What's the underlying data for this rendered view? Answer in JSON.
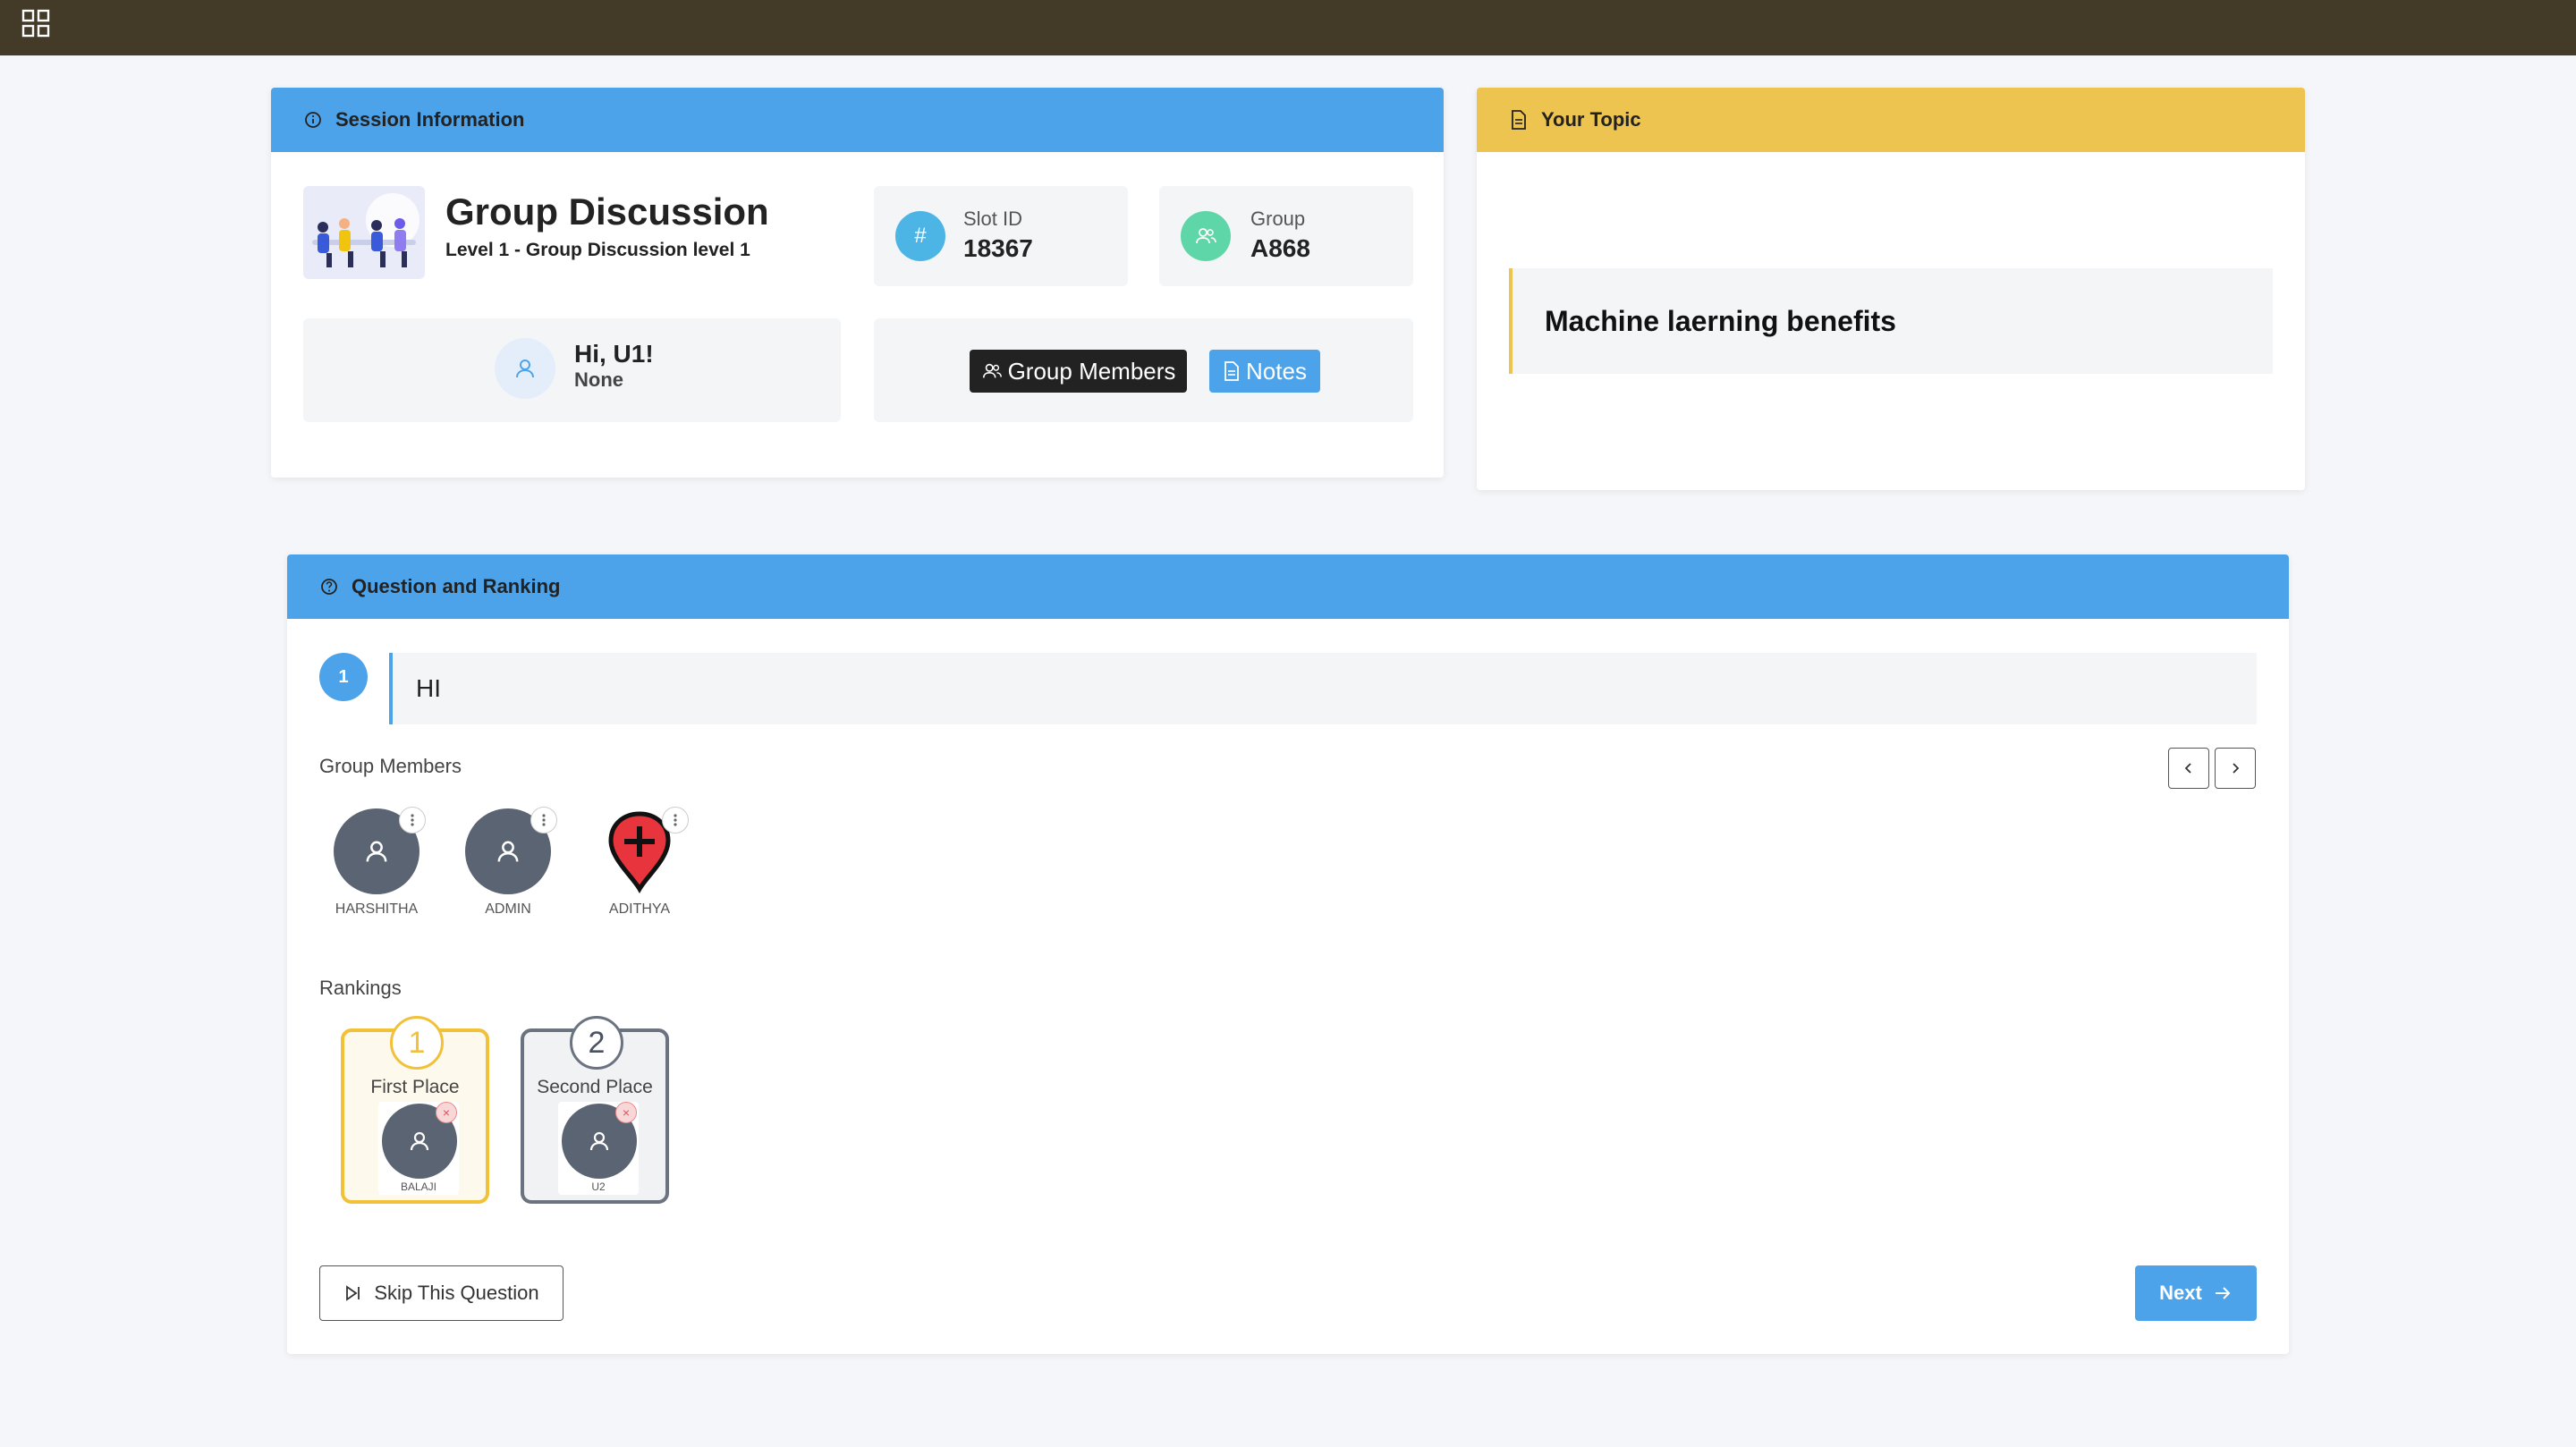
{
  "topbar": {
    "apps_icon": "grid-icon"
  },
  "session": {
    "header": "Session Information",
    "title": "Group Discussion",
    "subtitle": "Level 1 - Group Discussion level 1",
    "slot": {
      "label": "Slot ID",
      "value": "18367",
      "icon": "hash-icon"
    },
    "group": {
      "label": "Group",
      "value": "A868",
      "icon": "users-icon"
    },
    "user": {
      "greeting": "Hi, U1!",
      "role": "None"
    },
    "buttons": {
      "members": "Group Members",
      "notes": "Notes"
    }
  },
  "topic": {
    "header": "Your Topic",
    "text": "Machine laerning benefits"
  },
  "question": {
    "header": "Question and Ranking",
    "number": "1",
    "text": "HI",
    "members_label": "Group Members",
    "members": [
      {
        "name": "HARSHITHA"
      },
      {
        "name": "ADMIN"
      },
      {
        "name": "ADITHYA"
      }
    ],
    "rankings_label": "Rankings",
    "rankings": [
      {
        "num": "1",
        "label": "First Place",
        "name": "BALAJI"
      },
      {
        "num": "2",
        "label": "Second Place",
        "name": "U2"
      }
    ],
    "skip_label": "Skip This Question",
    "next_label": "Next"
  },
  "colors": {
    "topbar": "#433b27",
    "blue": "#4da3ea",
    "yellow": "#ecc44f",
    "first_place": "#f2c13a",
    "second_place": "#6b7280"
  }
}
